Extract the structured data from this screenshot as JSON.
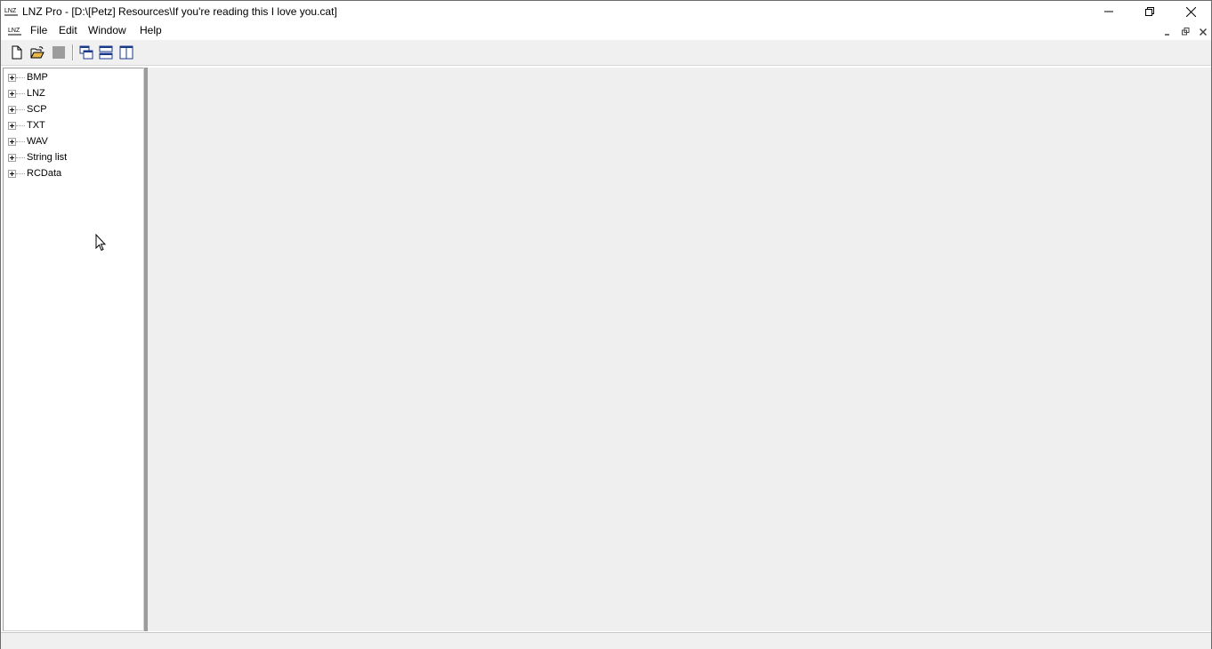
{
  "window": {
    "title": "LNZ Pro - [D:\\[Petz] Resources\\If you're reading this I love you.cat]",
    "app_icon": "lnz-app-icon",
    "caption_buttons": [
      "minimize-icon",
      "restore-icon",
      "close-icon"
    ]
  },
  "menu": {
    "items": [
      "File",
      "Edit",
      "Window",
      "Help"
    ],
    "mdi_buttons": [
      "minimize-icon",
      "restore-icon",
      "close-icon"
    ]
  },
  "toolbar": {
    "buttons": [
      "new-file-icon",
      "open-folder-icon",
      "save-icon",
      "cascade-windows-icon",
      "tile-horizontal-icon",
      "tile-vertical-icon"
    ]
  },
  "tree": {
    "items": [
      "BMP",
      "LNZ",
      "SCP",
      "TXT",
      "WAV",
      "String list",
      "RCData"
    ]
  },
  "colors": {
    "toolbar_bg": "#f0f0f0",
    "mdi_bg": "#efefef",
    "icon_blue": "#1a3a8c",
    "folder_yellow": "#e8b84a"
  }
}
